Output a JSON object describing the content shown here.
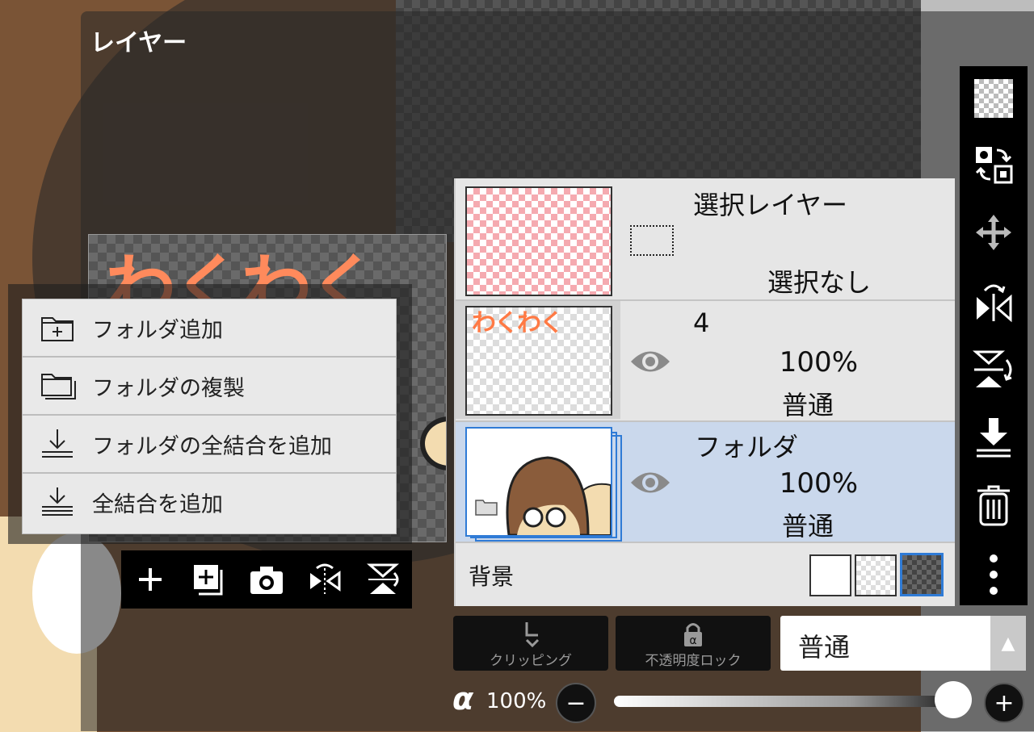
{
  "dialog": {
    "title": "レイヤー"
  },
  "preview": {
    "canvas_text": "わくわく"
  },
  "folder_menu": {
    "items": [
      {
        "label": "フォルダ追加",
        "icon": "folder-add-icon"
      },
      {
        "label": "フォルダの複製",
        "icon": "folder-duplicate-icon"
      },
      {
        "label": "フォルダの全結合を追加",
        "icon": "merge-down-icon"
      },
      {
        "label": "全結合を追加",
        "icon": "merge-down-icon"
      }
    ]
  },
  "preview_toolbar": [
    "add-icon",
    "add-layer-icon",
    "camera-icon",
    "flip-horizontal-icon",
    "flip-vertical-icon"
  ],
  "layers": {
    "selection": {
      "name": "選択レイヤー",
      "status": "選択なし"
    },
    "rows": [
      {
        "name": "4",
        "thumb_text": "わくわく",
        "opacity": "100%",
        "blend": "普通",
        "selected": false
      },
      {
        "name": "フォルダ",
        "opacity": "100%",
        "blend": "普通",
        "selected": true
      }
    ],
    "background": {
      "label": "背景"
    }
  },
  "bottom": {
    "clipping_label": "クリッピング",
    "alpha_lock_label": "不透明度ロック",
    "blend_mode": "普通",
    "alpha_symbol": "α",
    "opacity_value": "100%",
    "opacity_fraction": 1.0
  },
  "colors": {
    "selected_row": "#cad8ec",
    "accent_blue": "#2f7bd6"
  }
}
